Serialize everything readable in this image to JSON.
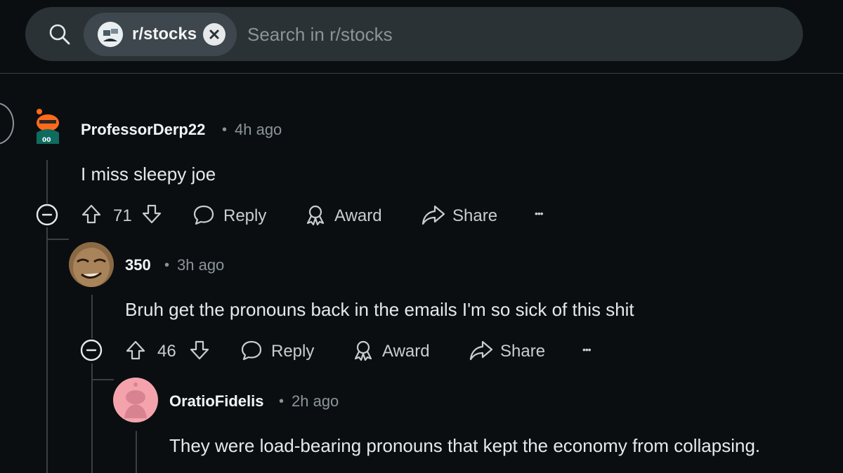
{
  "search": {
    "chip_label": "r/stocks",
    "placeholder": "Search in r/stocks"
  },
  "comments": [
    {
      "username": "ProfessorDerp22",
      "sep": "•",
      "time": "4h ago",
      "body": "I miss sleepy joe",
      "votes": "71",
      "reply_label": "Reply",
      "award_label": "Award",
      "share_label": "Share",
      "more_label": "•••"
    },
    {
      "username": "350",
      "sep": "•",
      "time": "3h ago",
      "body": "Bruh get the pronouns back in the emails I'm so sick of this shit",
      "votes": "46",
      "reply_label": "Reply",
      "award_label": "Award",
      "share_label": "Share",
      "more_label": "•••"
    },
    {
      "username": "OratioFidelis",
      "sep": "•",
      "time": "2h ago",
      "body": "They were load-bearing pronouns that kept the economy from collapsing."
    }
  ],
  "colors": {
    "background": "#0b0e11",
    "search_bg": "#2a3236",
    "chip_bg": "#3e474d",
    "thread_line": "#3a3f43",
    "muted": "#8a9599"
  }
}
